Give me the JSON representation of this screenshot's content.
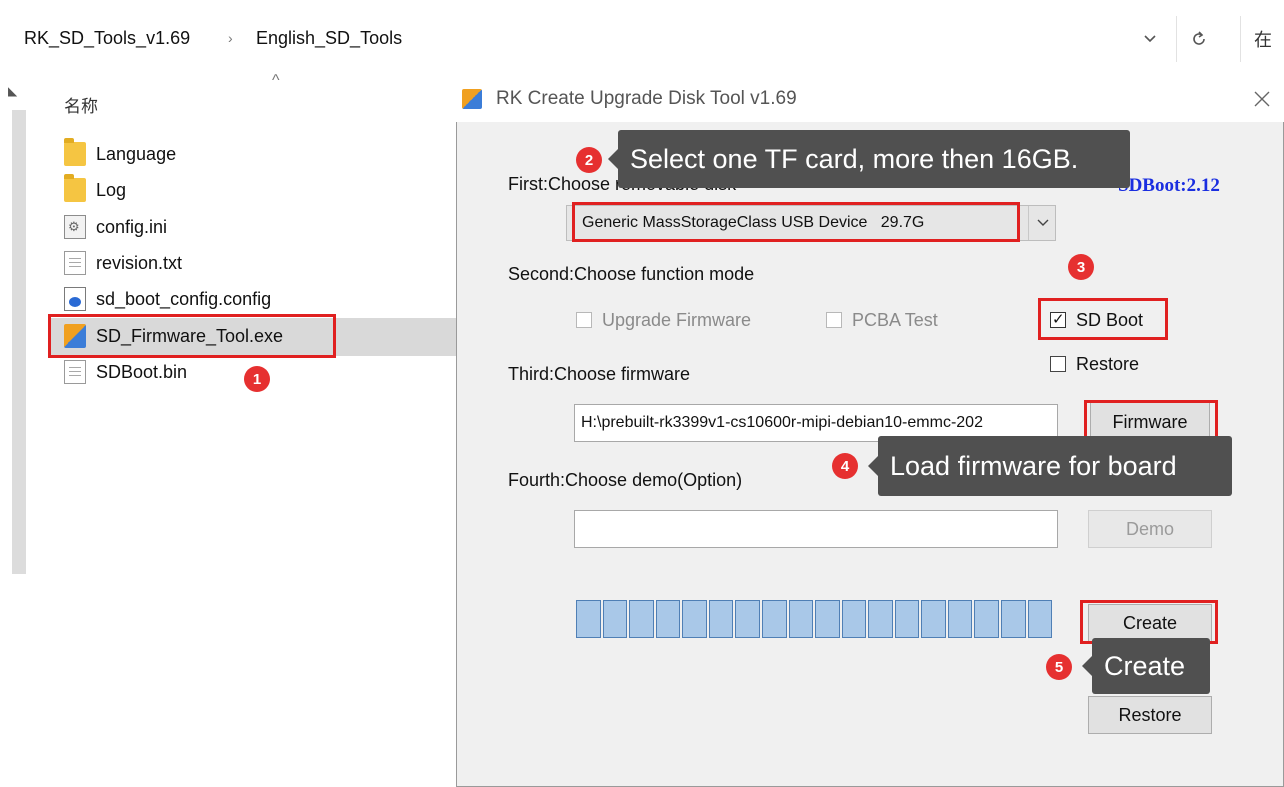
{
  "explorer": {
    "breadcrumb": [
      "RK_SD_Tools_v1.69",
      "English_SD_Tools"
    ],
    "breadcrumb_sep": "›",
    "dropdown_icon": "chevron-down-icon",
    "refresh_icon": "refresh-icon",
    "search_partial": "在",
    "column_header": "名称",
    "files": [
      {
        "name": "Language",
        "icon": "folder-icon"
      },
      {
        "name": "Log",
        "icon": "folder-icon"
      },
      {
        "name": "config.ini",
        "icon": "settings-file-icon"
      },
      {
        "name": "revision.txt",
        "icon": "text-file-icon"
      },
      {
        "name": "sd_boot_config.config",
        "icon": "config-file-icon"
      },
      {
        "name": "SD_Firmware_Tool.exe",
        "icon": "exe-icon",
        "selected": true
      },
      {
        "name": "SDBoot.bin",
        "icon": "file-icon"
      }
    ]
  },
  "dialog": {
    "title": "RK Create Upgrade Disk Tool v1.69",
    "close": "✕",
    "sdboot_version": "SDBoot:2.12",
    "step1_label": "First:Choose removable disk",
    "disk_selected": "Generic MassStorageClass USB Device   29.7G",
    "step2_label": "Second:Choose function mode",
    "mode_upgrade": "Upgrade Firmware",
    "mode_pcba": "PCBA Test",
    "mode_sdboot": "SD Boot",
    "mode_restore": "Restore",
    "step3_label": "Third:Choose firmware",
    "firmware_path": "H:\\prebuilt-rk3399v1-cs10600r-mipi-debian10-emmc-202",
    "firmware_button": "Firmware",
    "step4_label": "Fourth:Choose demo(Option)",
    "demo_path": "",
    "demo_button": "Demo",
    "progress_cells": 18,
    "create_button": "Create",
    "restore_button": "Restore"
  },
  "annotations": {
    "badge1": "1",
    "badge2": "2",
    "tip2": "Select one TF card, more then 16GB.",
    "badge3": "3",
    "badge4": "4",
    "tip4": "Load firmware for board",
    "badge5": "5",
    "tip5": "Create"
  },
  "colors": {
    "annotation_red": "#e02020",
    "tooltip_bg": "#505050",
    "sdboot_blue": "#1a2ee0",
    "progress_fill": "#a9c8e8"
  }
}
